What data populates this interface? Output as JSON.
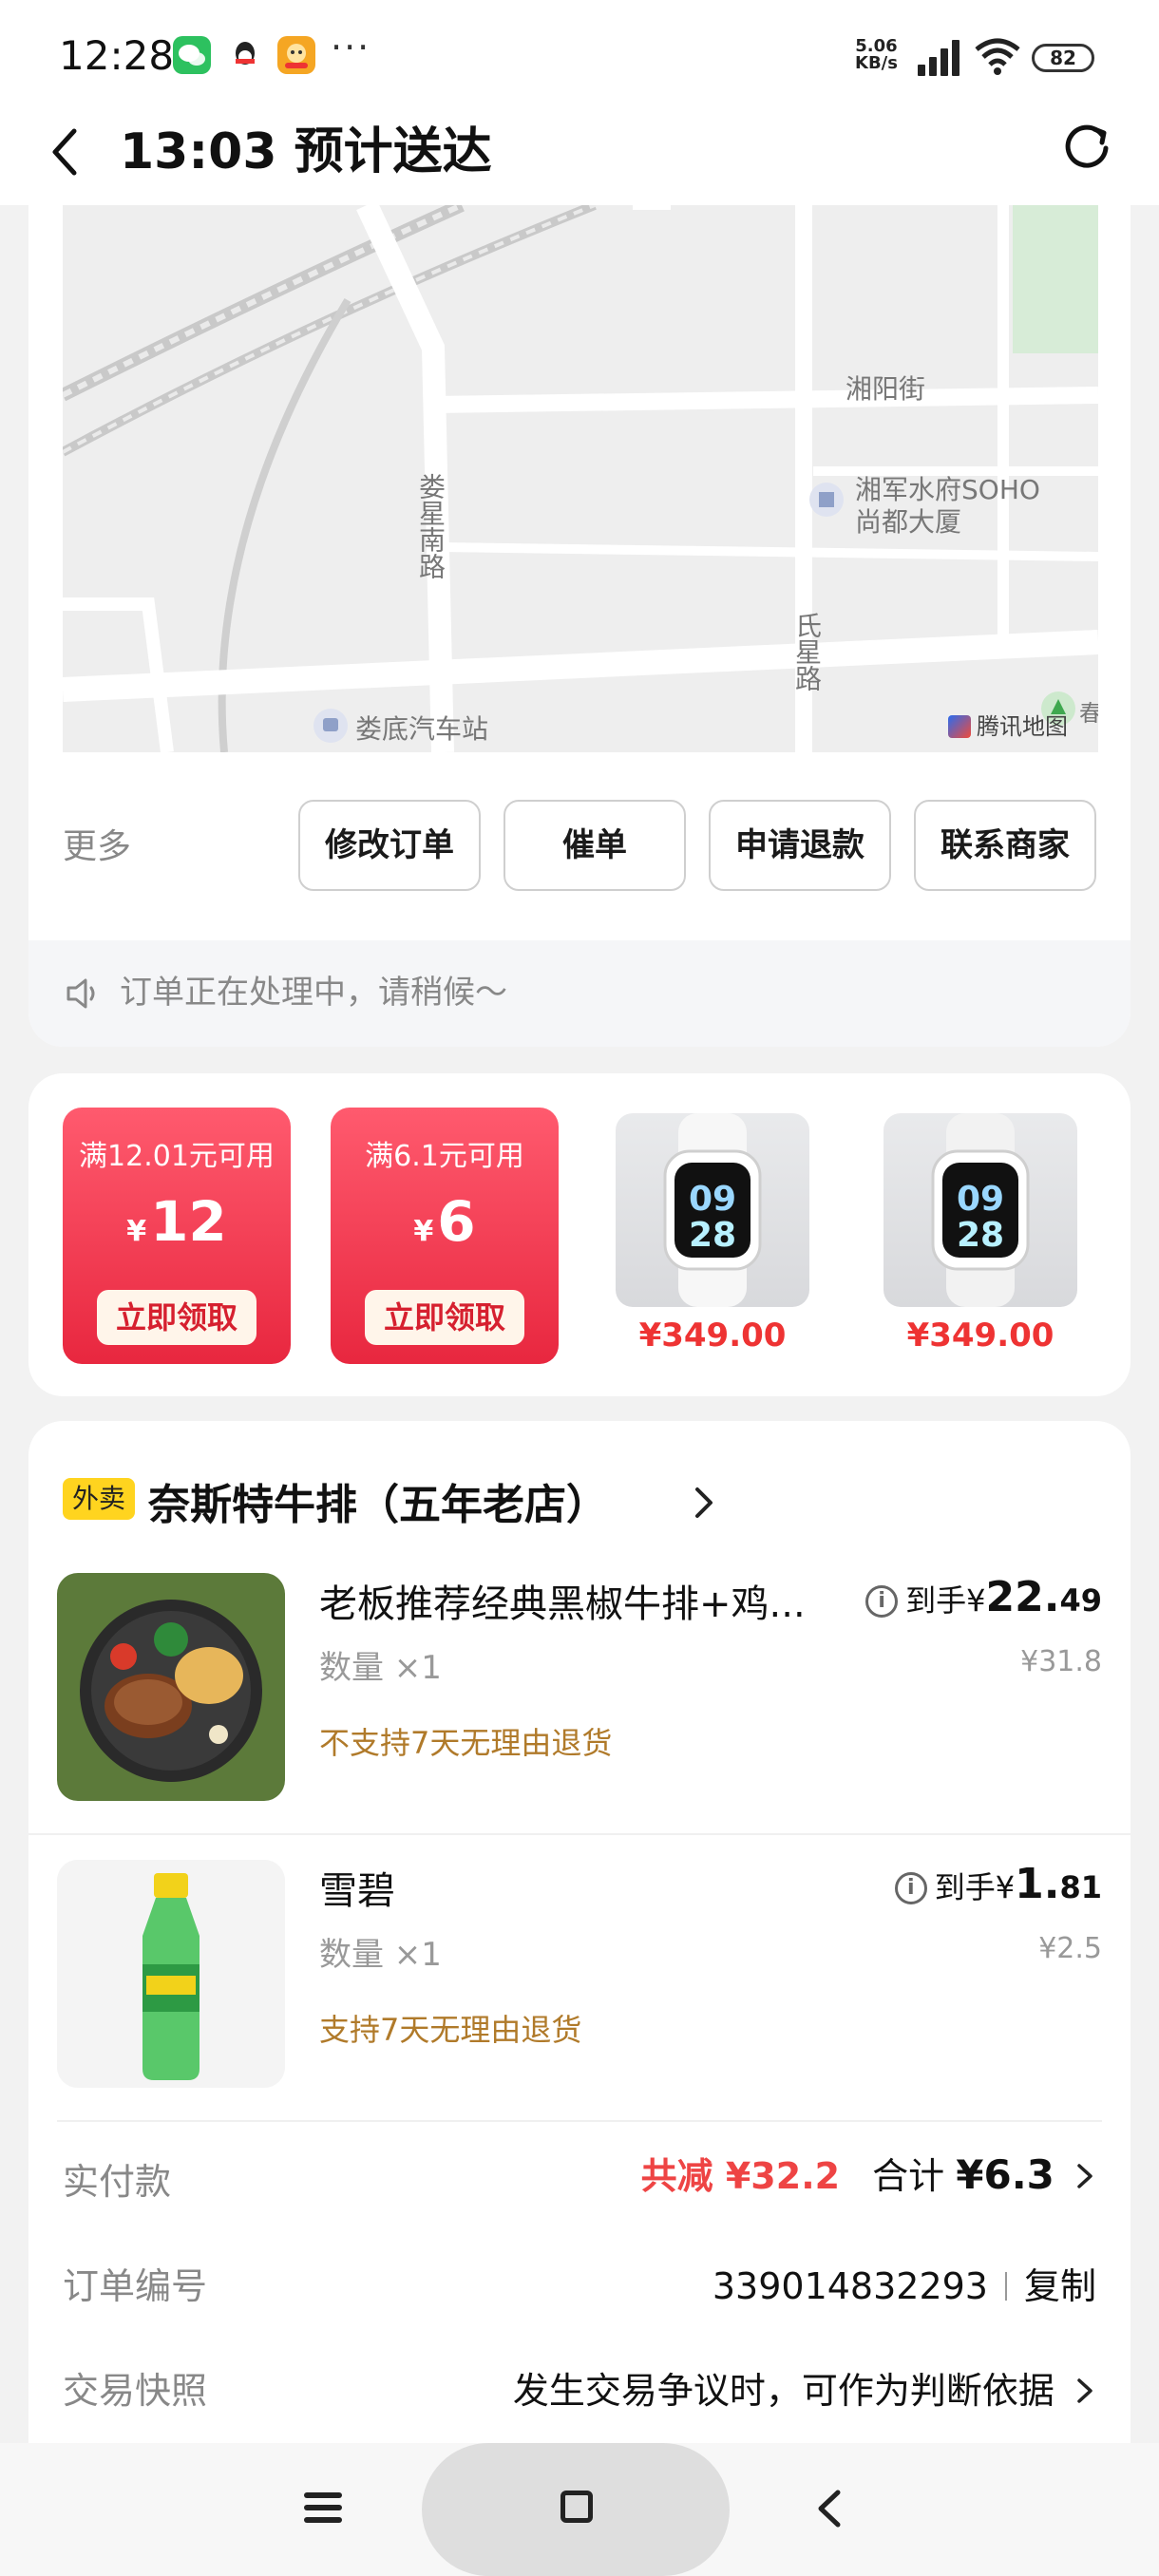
{
  "status_bar": {
    "time": "12:28",
    "net_speed_value": "5.06",
    "net_speed_unit": "KB/s",
    "battery": "82",
    "more": "···"
  },
  "header": {
    "title": "13:03 预计送达",
    "back_icon": "chevron-left-icon",
    "refresh_icon": "refresh-icon"
  },
  "map": {
    "labels": {
      "street1": "湘阳街",
      "poi": "湘军水府SOHO",
      "poi2": "尚都大厦",
      "road1": "娄星南路",
      "road2": "氏星路",
      "station": "娄底汽车站",
      "brand": "腾讯地图",
      "edge": "春"
    }
  },
  "actions": {
    "more_label": "更多",
    "buttons": [
      "修改订单",
      "催单",
      "申请退款",
      "联系商家"
    ]
  },
  "notice": {
    "text": "订单正在处理中，请稍候～",
    "icon": "speaker-icon"
  },
  "coupons": [
    {
      "condition": "满12.01元可用",
      "currency": "¥",
      "amount": "12",
      "button": "立即领取"
    },
    {
      "condition": "满6.1元可用",
      "currency": "¥",
      "amount": "6",
      "button": "立即领取"
    }
  ],
  "products": [
    {
      "price": "¥349.00",
      "watch_time_top": "09",
      "watch_time_bottom": "28"
    },
    {
      "price": "¥349.00",
      "watch_time_top": "09",
      "watch_time_bottom": "28"
    }
  ],
  "order": {
    "tag": "外卖",
    "store_name": "奈斯特牛排（五年老店）",
    "items": [
      {
        "name": "老板推荐经典黑椒牛排+鸡...",
        "qty": "数量 ×1",
        "policy": "不支持7天无理由退货",
        "final_prefix": "到手¥",
        "final_int": "22.",
        "final_dec": "49",
        "original": "¥31.8"
      },
      {
        "name": "雪碧",
        "qty": "数量 ×1",
        "policy": "支持7天无理由退货",
        "final_prefix": "到手¥",
        "final_int": "1.",
        "final_dec": "81",
        "original": "¥2.5"
      }
    ],
    "paid_label": "实付款",
    "discount": "共减 ¥32.2",
    "total_label": "合计 ",
    "total": "¥6.3",
    "order_no_label": "订单编号",
    "order_no": "339014832293",
    "copy_label": "复制",
    "snapshot_label": "交易快照",
    "snapshot_value": "发生交易争议时，可作为判断依据"
  },
  "colors": {
    "accent_red": "#e44444",
    "coupon_red": "#e8273f",
    "policy_brown": "#b07a2a",
    "tag_yellow": "#ffd41f"
  }
}
